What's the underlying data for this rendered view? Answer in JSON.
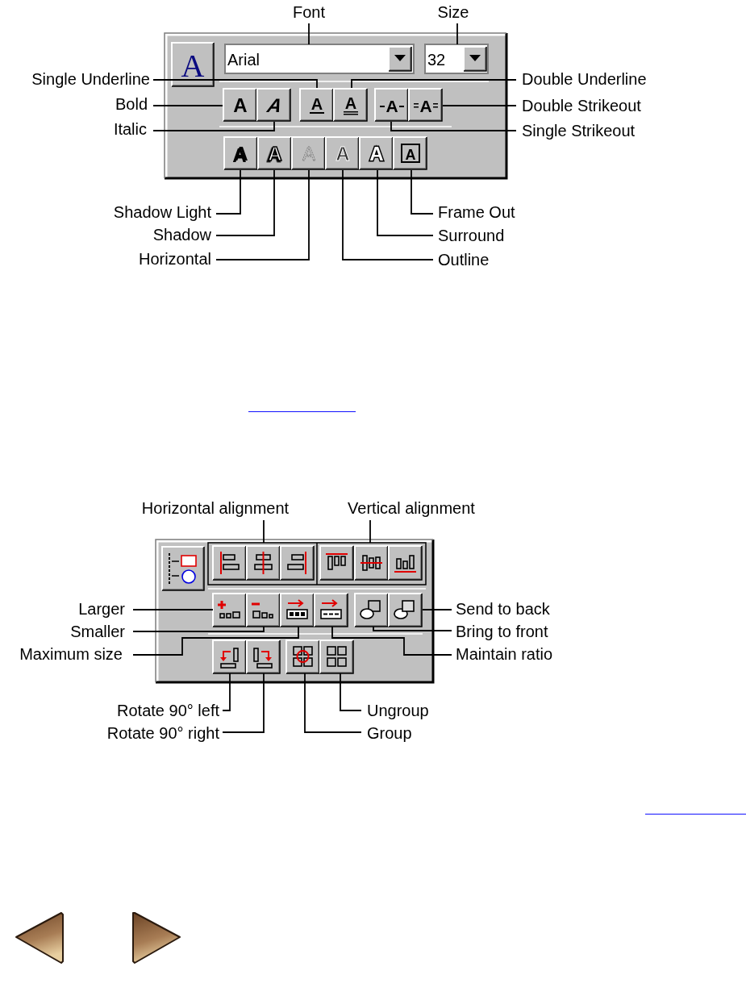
{
  "font_toolbar": {
    "style_button": {
      "glyph": "A"
    },
    "font_field": {
      "value": "Arial"
    },
    "size_field": {
      "value": "32"
    },
    "buttons": [
      {
        "glyph": "A",
        "kind": "bold"
      },
      {
        "glyph": "A",
        "kind": "italic"
      },
      {
        "glyph": "A",
        "kind": "underline"
      },
      {
        "glyph": "A",
        "kind": "double-underline"
      },
      {
        "glyph": "A",
        "kind": "strikeout"
      },
      {
        "glyph": "A",
        "kind": "double-strikeout"
      },
      {
        "glyph": "A",
        "kind": "shadow-light"
      },
      {
        "glyph": "A",
        "kind": "shadow"
      },
      {
        "glyph": "A",
        "kind": "horizontal"
      },
      {
        "glyph": "A",
        "kind": "outline"
      },
      {
        "glyph": "A",
        "kind": "surround"
      },
      {
        "glyph": "A",
        "kind": "frame"
      }
    ],
    "callouts": [
      {
        "label": "Font"
      },
      {
        "label": "Size"
      },
      {
        "label": "Single Underline"
      },
      {
        "label": "Double Underline"
      },
      {
        "label": "Bold"
      },
      {
        "label": "Double Strikeout"
      },
      {
        "label": "Italic"
      },
      {
        "label": "Single Strikeout"
      },
      {
        "label": "Shadow Light"
      },
      {
        "label": "Frame Out"
      },
      {
        "label": "Shadow"
      },
      {
        "label": "Surround"
      },
      {
        "label": "Horizontal"
      },
      {
        "label": "Outline"
      }
    ]
  },
  "layout_toolbar": {
    "buttons": [
      {
        "kind": "align-objects"
      },
      {
        "kind": "align-left"
      },
      {
        "kind": "align-center"
      },
      {
        "kind": "align-right"
      },
      {
        "kind": "align-top"
      },
      {
        "kind": "align-middle"
      },
      {
        "kind": "align-bottom"
      },
      {
        "kind": "larger"
      },
      {
        "kind": "smaller"
      },
      {
        "kind": "maximum"
      },
      {
        "kind": "ratio"
      },
      {
        "kind": "bring-front"
      },
      {
        "kind": "send-back"
      },
      {
        "kind": "rotate-left"
      },
      {
        "kind": "rotate-right"
      },
      {
        "kind": "group"
      },
      {
        "kind": "ungroup"
      }
    ],
    "callouts": [
      {
        "label": "Horizontal alignment"
      },
      {
        "label": "Vertical alignment"
      },
      {
        "label": "Larger"
      },
      {
        "label": "Send to back"
      },
      {
        "label": "Smaller"
      },
      {
        "label": "Bring to front"
      },
      {
        "label": "Maximum size"
      },
      {
        "label": "Maintain ratio"
      },
      {
        "label": "Rotate 90° left"
      },
      {
        "label": "Ungroup"
      },
      {
        "label": "Rotate 90° right"
      },
      {
        "label": "Group"
      }
    ]
  },
  "navigation": [
    {
      "kind": "previous"
    },
    {
      "kind": "next"
    }
  ]
}
